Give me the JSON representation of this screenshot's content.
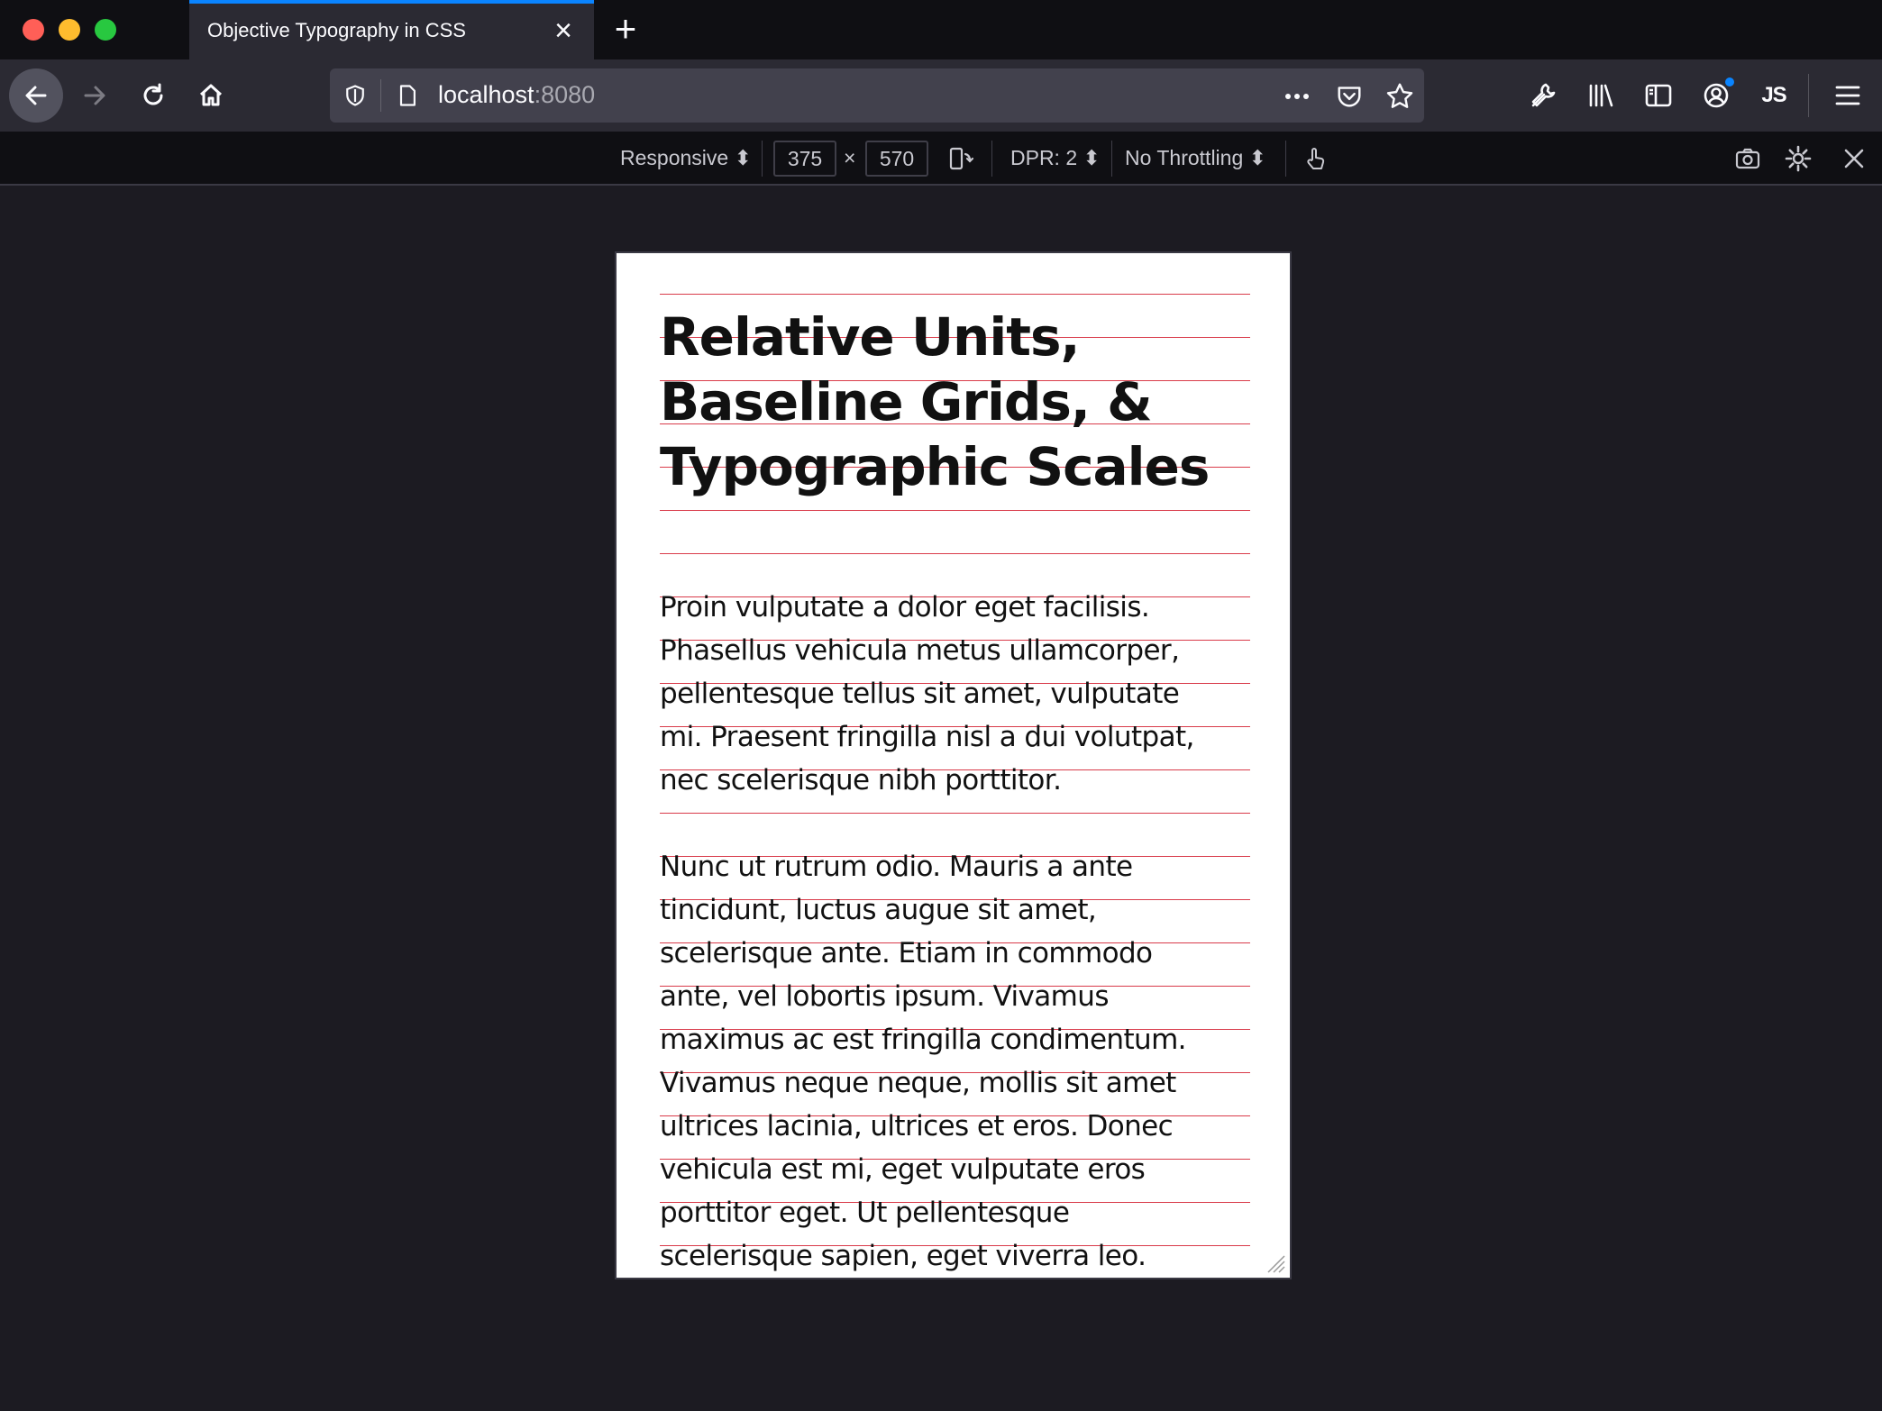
{
  "window": {
    "tab_title": "Objective Typography in CSS",
    "url_host": "localhost",
    "url_port": ":8080",
    "accent": "#0a84ff"
  },
  "rdm": {
    "device": "Responsive ⬍",
    "width": "375",
    "times": "×",
    "height": "570",
    "dpr": "DPR: 2 ⬍",
    "throttling": "No Throttling ⬍"
  },
  "toolbar": {
    "js_badge": "JS"
  },
  "page": {
    "heading_lines": [
      "Relative Units,",
      "Baseline Grids, &",
      "Typographic Scales"
    ],
    "paragraph1_lines": [
      "Proin vulputate a dolor eget facilisis.",
      "Phasellus vehicula metus ullamcorper,",
      "pellentesque tellus sit amet, vulputate",
      "mi. Praesent fringilla nisl a dui volutpat,",
      "nec scelerisque nibh porttitor."
    ],
    "paragraph2_lines": [
      "Nunc ut rutrum odio. Mauris a ante",
      "tincidunt, luctus augue sit amet,",
      "scelerisque ante. Etiam in commodo",
      "ante, vel lobortis ipsum. Vivamus",
      "maximus ac est fringilla condimentum.",
      "Vivamus neque neque, mollis sit amet",
      "ultrices lacinia, ultrices et eros. Donec",
      "vehicula est mi, eget vulputate eros",
      "porttitor eget. Ut pellentesque",
      "scelerisque sapien, eget viverra leo."
    ],
    "baseline_color": "#d93b4a"
  }
}
